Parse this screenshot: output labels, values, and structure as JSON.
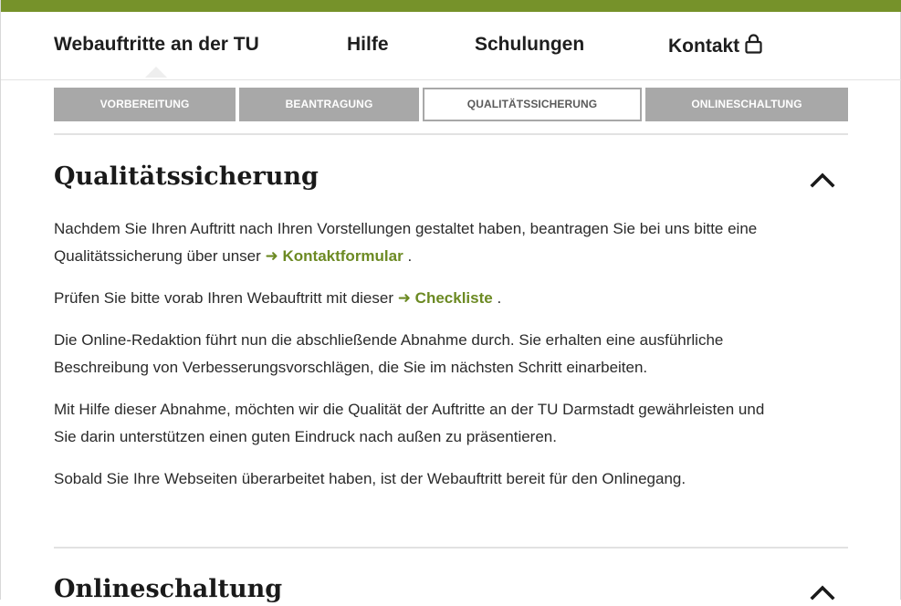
{
  "nav": {
    "items": [
      {
        "label": "Webauftritte an der TU"
      },
      {
        "label": "Hilfe"
      },
      {
        "label": "Schulungen"
      },
      {
        "label": "Kontakt"
      }
    ]
  },
  "tabs": [
    {
      "label": "VORBEREITUNG"
    },
    {
      "label": "BEANTRAGUNG"
    },
    {
      "label": "QUALITÄTSSICHERUNG",
      "active": true
    },
    {
      "label": "ONLINESCHALTUNG"
    }
  ],
  "section": {
    "title": "Qualitätssicherung",
    "p1_text": "Nachdem Sie Ihren Auftritt nach Ihren Vorstellungen gestaltet haben, beantragen Sie bei uns bitte eine Qualitätssicherung über unser ",
    "p1_link": "➜ Kontaktformular",
    "p1_end": " .",
    "p2_text": "Prüfen Sie bitte vorab Ihren Webauftritt mit dieser ",
    "p2_link": "➜ Checkliste",
    "p2_end": " .",
    "p3": "Die Online-Redaktion führt nun die abschließende Abnahme durch. Sie erhalten eine ausführliche Beschreibung von Verbesserungsvorschlägen, die Sie im nächsten Schritt einarbeiten.",
    "p4": "Mit Hilfe dieser Abnahme, möchten wir die Qualität der Auftritte an der TU Darmstadt gewährleisten und Sie darin unterstützen einen guten Eindruck nach außen zu präsentieren.",
    "p5": "Sobald Sie Ihre Webseiten überarbeitet haben, ist der Webauftritt bereit für den Onlinegang."
  },
  "next_section": {
    "title": "Onlineschaltung"
  },
  "icons": {
    "kontakt": "lock-icon",
    "section_toggle": "chevron-up-icon",
    "next_section_toggle": "chevron-up-icon"
  },
  "colors": {
    "brand_green": "#76922a",
    "link_green": "#6c8a23",
    "tab_gray": "#a8a8a8"
  }
}
